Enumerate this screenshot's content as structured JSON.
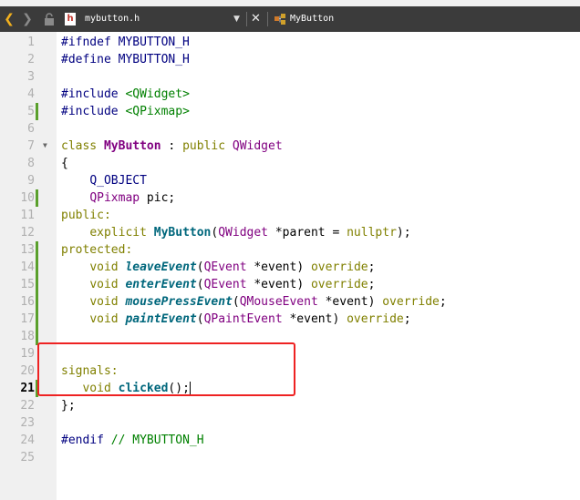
{
  "toolbar": {
    "file_name": "mybutton.h",
    "symbol": "MyButton",
    "file_type_glyph": "h"
  },
  "editor": {
    "current_line": 21,
    "accent_green": "#5aa02c",
    "highlight_color": "#ee2222",
    "lines": [
      {
        "number": "1",
        "tokens": [
          {
            "t": "#ifndef MYBUTTON_H",
            "c": "pp"
          }
        ]
      },
      {
        "number": "2",
        "tokens": [
          {
            "t": "#define MYBUTTON_H",
            "c": "pp"
          }
        ]
      },
      {
        "number": "3",
        "tokens": []
      },
      {
        "number": "4",
        "tokens": [
          {
            "t": "#include ",
            "c": "pp"
          },
          {
            "t": "<QWidget>",
            "c": "str"
          }
        ]
      },
      {
        "number": "5",
        "modified": true,
        "tokens": [
          {
            "t": "#include ",
            "c": "pp"
          },
          {
            "t": "<QPixmap>",
            "c": "str"
          }
        ]
      },
      {
        "number": "6",
        "tokens": []
      },
      {
        "number": "7",
        "fold": true,
        "tokens": [
          {
            "t": "class ",
            "c": "kw"
          },
          {
            "t": "MyButton",
            "c": "cls bold"
          },
          {
            "t": " : ",
            "c": ""
          },
          {
            "t": "public ",
            "c": "kw"
          },
          {
            "t": "QWidget",
            "c": "cls"
          }
        ]
      },
      {
        "number": "8",
        "tokens": [
          {
            "t": "{",
            "c": ""
          }
        ]
      },
      {
        "number": "9",
        "tokens": [
          {
            "t": "    ",
            "c": ""
          },
          {
            "t": "Q_OBJECT",
            "c": "mac"
          }
        ]
      },
      {
        "number": "10",
        "modified": true,
        "tokens": [
          {
            "t": "    ",
            "c": ""
          },
          {
            "t": "QPixmap",
            "c": "cls"
          },
          {
            "t": " pic;",
            "c": ""
          }
        ]
      },
      {
        "number": "11",
        "tokens": [
          {
            "t": "public:",
            "c": "kw"
          }
        ]
      },
      {
        "number": "12",
        "tokens": [
          {
            "t": "    ",
            "c": ""
          },
          {
            "t": "explicit ",
            "c": "kw"
          },
          {
            "t": "MyButton",
            "c": "fn"
          },
          {
            "t": "(",
            "c": ""
          },
          {
            "t": "QWidget",
            "c": "cls"
          },
          {
            "t": " *parent = ",
            "c": ""
          },
          {
            "t": "nullptr",
            "c": "kw"
          },
          {
            "t": ");",
            "c": ""
          }
        ]
      },
      {
        "number": "13",
        "modified": true,
        "tokens": [
          {
            "t": "protected:",
            "c": "kw"
          }
        ]
      },
      {
        "number": "14",
        "modified": true,
        "tokens": [
          {
            "t": "    ",
            "c": ""
          },
          {
            "t": "void ",
            "c": "kw"
          },
          {
            "t": "leaveEvent",
            "c": "fni"
          },
          {
            "t": "(",
            "c": ""
          },
          {
            "t": "QEvent",
            "c": "cls"
          },
          {
            "t": " *event) ",
            "c": ""
          },
          {
            "t": "override",
            "c": "kw"
          },
          {
            "t": ";",
            "c": ""
          }
        ]
      },
      {
        "number": "15",
        "modified": true,
        "tokens": [
          {
            "t": "    ",
            "c": ""
          },
          {
            "t": "void ",
            "c": "kw"
          },
          {
            "t": "enterEvent",
            "c": "fni"
          },
          {
            "t": "(",
            "c": ""
          },
          {
            "t": "QEvent",
            "c": "cls"
          },
          {
            "t": " *event) ",
            "c": ""
          },
          {
            "t": "override",
            "c": "kw"
          },
          {
            "t": ";",
            "c": ""
          }
        ]
      },
      {
        "number": "16",
        "modified": true,
        "tokens": [
          {
            "t": "    ",
            "c": ""
          },
          {
            "t": "void ",
            "c": "kw"
          },
          {
            "t": "mousePressEvent",
            "c": "fni"
          },
          {
            "t": "(",
            "c": ""
          },
          {
            "t": "QMouseEvent",
            "c": "cls"
          },
          {
            "t": " *event) ",
            "c": ""
          },
          {
            "t": "override",
            "c": "kw"
          },
          {
            "t": ";",
            "c": ""
          }
        ]
      },
      {
        "number": "17",
        "modified": true,
        "tokens": [
          {
            "t": "    ",
            "c": ""
          },
          {
            "t": "void ",
            "c": "kw"
          },
          {
            "t": "paintEvent",
            "c": "fni"
          },
          {
            "t": "(",
            "c": ""
          },
          {
            "t": "QPaintEvent",
            "c": "cls"
          },
          {
            "t": " *event) ",
            "c": ""
          },
          {
            "t": "override",
            "c": "kw"
          },
          {
            "t": ";",
            "c": ""
          }
        ]
      },
      {
        "number": "18",
        "modified": true,
        "tokens": []
      },
      {
        "number": "19",
        "tokens": []
      },
      {
        "number": "20",
        "tokens": [
          {
            "t": "signals:",
            "c": "kw"
          }
        ]
      },
      {
        "number": "21",
        "modified": true,
        "cursor": true,
        "tokens": [
          {
            "t": "   ",
            "c": ""
          },
          {
            "t": "void ",
            "c": "kw"
          },
          {
            "t": "clicked",
            "c": "fn"
          },
          {
            "t": "();",
            "c": ""
          }
        ]
      },
      {
        "number": "22",
        "tokens": [
          {
            "t": "};",
            "c": ""
          }
        ]
      },
      {
        "number": "23",
        "tokens": []
      },
      {
        "number": "24",
        "tokens": [
          {
            "t": "#endif ",
            "c": "pp"
          },
          {
            "t": "// MYBUTTON_H",
            "c": "cmt"
          }
        ]
      },
      {
        "number": "25",
        "tokens": []
      }
    ]
  }
}
